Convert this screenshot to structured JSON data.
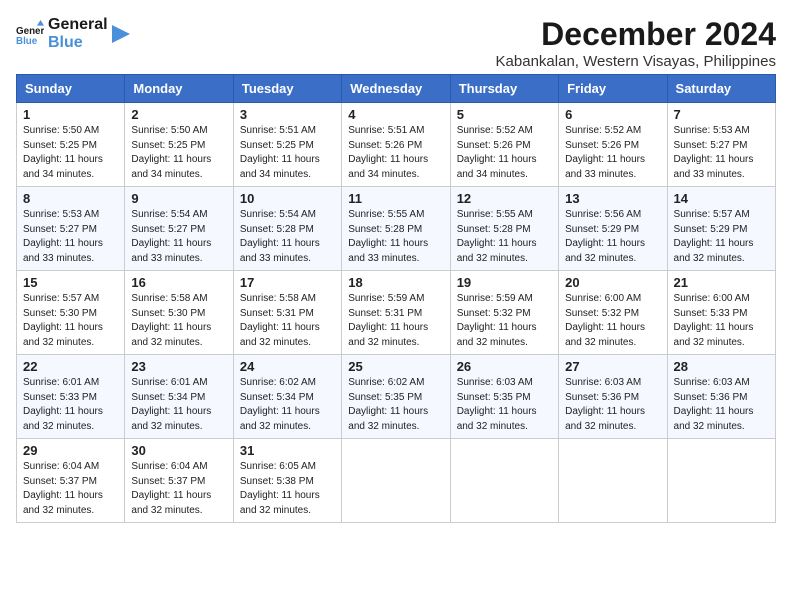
{
  "logo": {
    "line1": "General",
    "line2": "Blue"
  },
  "title": {
    "month": "December 2024",
    "location": "Kabankalan, Western Visayas, Philippines"
  },
  "headers": [
    "Sunday",
    "Monday",
    "Tuesday",
    "Wednesday",
    "Thursday",
    "Friday",
    "Saturday"
  ],
  "weeks": [
    [
      {
        "day": "1",
        "sunrise": "5:50 AM",
        "sunset": "5:25 PM",
        "daylight": "11 hours and 34 minutes."
      },
      {
        "day": "2",
        "sunrise": "5:50 AM",
        "sunset": "5:25 PM",
        "daylight": "11 hours and 34 minutes."
      },
      {
        "day": "3",
        "sunrise": "5:51 AM",
        "sunset": "5:25 PM",
        "daylight": "11 hours and 34 minutes."
      },
      {
        "day": "4",
        "sunrise": "5:51 AM",
        "sunset": "5:26 PM",
        "daylight": "11 hours and 34 minutes."
      },
      {
        "day": "5",
        "sunrise": "5:52 AM",
        "sunset": "5:26 PM",
        "daylight": "11 hours and 34 minutes."
      },
      {
        "day": "6",
        "sunrise": "5:52 AM",
        "sunset": "5:26 PM",
        "daylight": "11 hours and 33 minutes."
      },
      {
        "day": "7",
        "sunrise": "5:53 AM",
        "sunset": "5:27 PM",
        "daylight": "11 hours and 33 minutes."
      }
    ],
    [
      {
        "day": "8",
        "sunrise": "5:53 AM",
        "sunset": "5:27 PM",
        "daylight": "11 hours and 33 minutes."
      },
      {
        "day": "9",
        "sunrise": "5:54 AM",
        "sunset": "5:27 PM",
        "daylight": "11 hours and 33 minutes."
      },
      {
        "day": "10",
        "sunrise": "5:54 AM",
        "sunset": "5:28 PM",
        "daylight": "11 hours and 33 minutes."
      },
      {
        "day": "11",
        "sunrise": "5:55 AM",
        "sunset": "5:28 PM",
        "daylight": "11 hours and 33 minutes."
      },
      {
        "day": "12",
        "sunrise": "5:55 AM",
        "sunset": "5:28 PM",
        "daylight": "11 hours and 32 minutes."
      },
      {
        "day": "13",
        "sunrise": "5:56 AM",
        "sunset": "5:29 PM",
        "daylight": "11 hours and 32 minutes."
      },
      {
        "day": "14",
        "sunrise": "5:57 AM",
        "sunset": "5:29 PM",
        "daylight": "11 hours and 32 minutes."
      }
    ],
    [
      {
        "day": "15",
        "sunrise": "5:57 AM",
        "sunset": "5:30 PM",
        "daylight": "11 hours and 32 minutes."
      },
      {
        "day": "16",
        "sunrise": "5:58 AM",
        "sunset": "5:30 PM",
        "daylight": "11 hours and 32 minutes."
      },
      {
        "day": "17",
        "sunrise": "5:58 AM",
        "sunset": "5:31 PM",
        "daylight": "11 hours and 32 minutes."
      },
      {
        "day": "18",
        "sunrise": "5:59 AM",
        "sunset": "5:31 PM",
        "daylight": "11 hours and 32 minutes."
      },
      {
        "day": "19",
        "sunrise": "5:59 AM",
        "sunset": "5:32 PM",
        "daylight": "11 hours and 32 minutes."
      },
      {
        "day": "20",
        "sunrise": "6:00 AM",
        "sunset": "5:32 PM",
        "daylight": "11 hours and 32 minutes."
      },
      {
        "day": "21",
        "sunrise": "6:00 AM",
        "sunset": "5:33 PM",
        "daylight": "11 hours and 32 minutes."
      }
    ],
    [
      {
        "day": "22",
        "sunrise": "6:01 AM",
        "sunset": "5:33 PM",
        "daylight": "11 hours and 32 minutes."
      },
      {
        "day": "23",
        "sunrise": "6:01 AM",
        "sunset": "5:34 PM",
        "daylight": "11 hours and 32 minutes."
      },
      {
        "day": "24",
        "sunrise": "6:02 AM",
        "sunset": "5:34 PM",
        "daylight": "11 hours and 32 minutes."
      },
      {
        "day": "25",
        "sunrise": "6:02 AM",
        "sunset": "5:35 PM",
        "daylight": "11 hours and 32 minutes."
      },
      {
        "day": "26",
        "sunrise": "6:03 AM",
        "sunset": "5:35 PM",
        "daylight": "11 hours and 32 minutes."
      },
      {
        "day": "27",
        "sunrise": "6:03 AM",
        "sunset": "5:36 PM",
        "daylight": "11 hours and 32 minutes."
      },
      {
        "day": "28",
        "sunrise": "6:03 AM",
        "sunset": "5:36 PM",
        "daylight": "11 hours and 32 minutes."
      }
    ],
    [
      {
        "day": "29",
        "sunrise": "6:04 AM",
        "sunset": "5:37 PM",
        "daylight": "11 hours and 32 minutes."
      },
      {
        "day": "30",
        "sunrise": "6:04 AM",
        "sunset": "5:37 PM",
        "daylight": "11 hours and 32 minutes."
      },
      {
        "day": "31",
        "sunrise": "6:05 AM",
        "sunset": "5:38 PM",
        "daylight": "11 hours and 32 minutes."
      },
      null,
      null,
      null,
      null
    ]
  ]
}
